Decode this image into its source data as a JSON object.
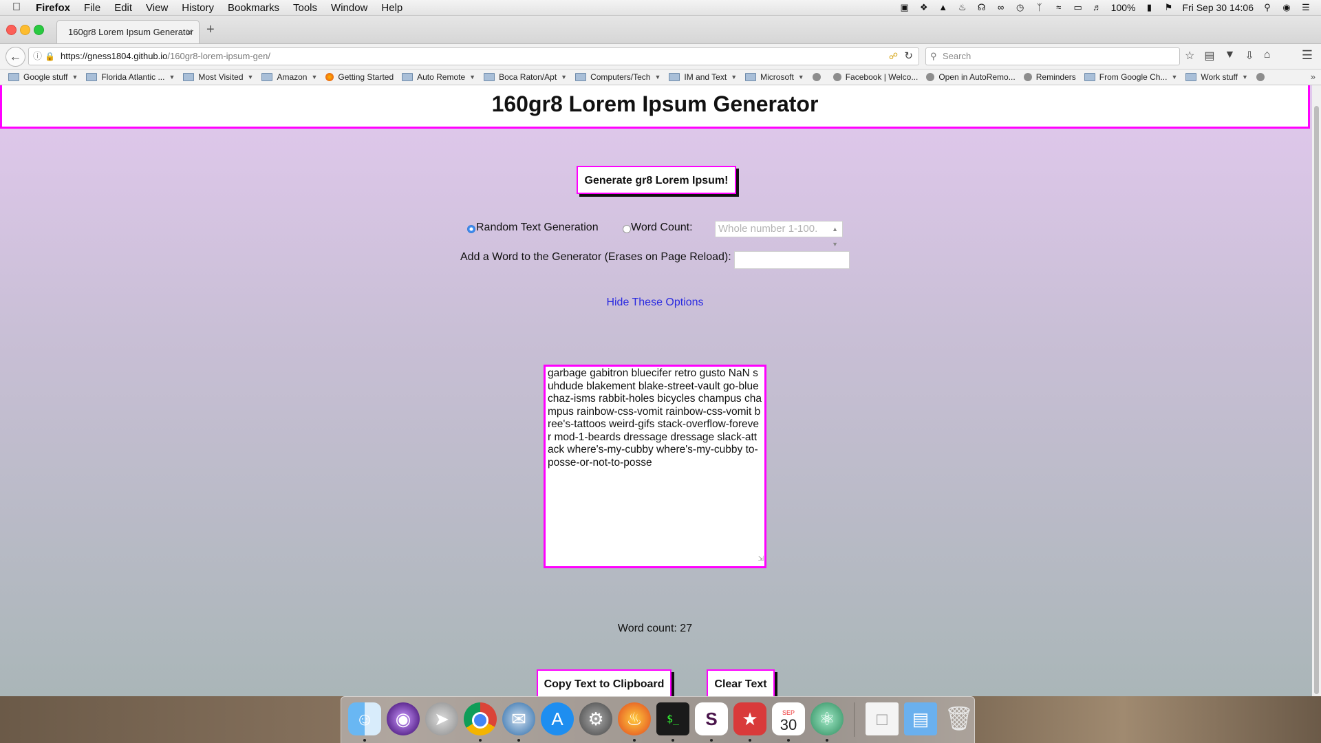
{
  "menubar": {
    "app_name": "Firefox",
    "items": [
      "File",
      "Edit",
      "View",
      "History",
      "Bookmarks",
      "Tools",
      "Window",
      "Help"
    ],
    "battery": "100%",
    "clock": "Fri Sep 30  14:06"
  },
  "browser": {
    "tab_title": "160gr8 Lorem Ipsum Generator",
    "url_host": "https://gness1804.github.io",
    "url_path": "/160gr8-lorem-ipsum-gen/",
    "search_placeholder": "Search"
  },
  "bookmarks": [
    {
      "label": "Google stuff",
      "type": "folder"
    },
    {
      "label": "Florida Atlantic ...",
      "type": "folder"
    },
    {
      "label": "Most Visited",
      "type": "folder"
    },
    {
      "label": "Amazon",
      "type": "folder"
    },
    {
      "label": "Getting Started",
      "type": "firefox"
    },
    {
      "label": "Auto Remote",
      "type": "folder"
    },
    {
      "label": "Boca Raton/Apt",
      "type": "folder"
    },
    {
      "label": "Computers/Tech",
      "type": "folder"
    },
    {
      "label": "IM and Text",
      "type": "folder"
    },
    {
      "label": "Microsoft",
      "type": "folder"
    },
    {
      "label": "",
      "type": "globe"
    },
    {
      "label": "Facebook | Welco...",
      "type": "globe"
    },
    {
      "label": "Open in AutoRemo...",
      "type": "globe"
    },
    {
      "label": "Reminders",
      "type": "globe"
    },
    {
      "label": "From Google Ch...",
      "type": "folder"
    },
    {
      "label": "Work stuff",
      "type": "folder"
    },
    {
      "label": "",
      "type": "globe"
    }
  ],
  "page": {
    "title": "160gr8 Lorem Ipsum Generator",
    "generate_button": "Generate gr8 Lorem Ipsum!",
    "radio_random_label": "Random Text Generation",
    "radio_wordcount_label": "Word Count:",
    "wordcount_placeholder": "Whole number 1-100.",
    "add_word_label": "Add a Word to the Generator (Erases on Page Reload):",
    "hide_options_link": "Hide These Options",
    "output_text": "garbage gabitron bluecifer retro gusto NaN suhdude blakement blake-street-vault go-blue chaz-isms rabbit-holes bicycles champus champus rainbow-css-vomit rainbow-css-vomit bree's-tattoos weird-gifs stack-overflow-forever mod-1-beards dressage dressage slack-attack where's-my-cubby where's-my-cubby to-posse-or-not-to-posse",
    "word_count": "Word count: 27",
    "copy_button": "Copy Text to Clipboard",
    "clear_button": "Clear Text"
  },
  "colors": {
    "accent": "#ff00ff",
    "link": "#2a2ae0"
  },
  "dock": {
    "apps": [
      "finder-icon",
      "siri-icon",
      "launchpad-icon",
      "chrome-icon",
      "thunderbird-icon",
      "app-store-icon",
      "system-preferences-icon",
      "firefox-icon",
      "terminal-icon",
      "slack-icon",
      "todo-icon",
      "calendar-icon",
      "atom-icon",
      "document-icon",
      "folder-icon",
      "trash-icon"
    ],
    "calendar_month": "SEP",
    "calendar_day": "30"
  }
}
